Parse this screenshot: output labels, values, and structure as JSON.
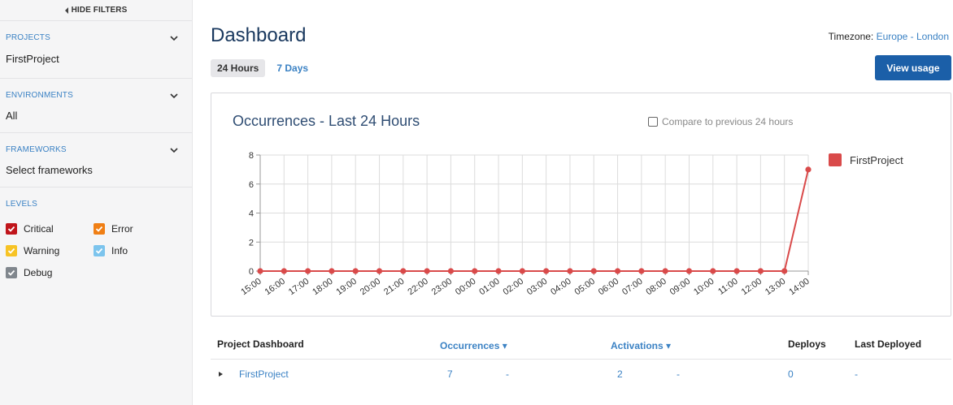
{
  "sidebar": {
    "hide_filters_label": "HIDE FILTERS",
    "projects": {
      "title": "PROJECTS",
      "value": "FirstProject"
    },
    "environments": {
      "title": "ENVIRONMENTS",
      "value": "All"
    },
    "frameworks": {
      "title": "FRAMEWORKS",
      "value": "Select frameworks"
    },
    "levels": {
      "title": "LEVELS",
      "items": [
        {
          "label": "Critical",
          "color": "#c0151b",
          "checked": true
        },
        {
          "label": "Error",
          "color": "#f07f15",
          "checked": true
        },
        {
          "label": "Warning",
          "color": "#f7c325",
          "checked": true
        },
        {
          "label": "Info",
          "color": "#7cc4ed",
          "checked": true
        },
        {
          "label": "Debug",
          "color": "#80868d",
          "checked": true
        }
      ]
    }
  },
  "header": {
    "title": "Dashboard",
    "timezone_label": "Timezone:",
    "timezone_value": "Europe - London",
    "view_usage_label": "View usage",
    "tabs": [
      {
        "label": "24 Hours",
        "active": true
      },
      {
        "label": "7 Days",
        "active": false
      }
    ]
  },
  "chart": {
    "compare_label": "Compare to previous 24 hours"
  },
  "chart_data": {
    "type": "line",
    "title": "Occurrences - Last 24 Hours",
    "categories": [
      "15:00",
      "16:00",
      "17:00",
      "18:00",
      "19:00",
      "20:00",
      "21:00",
      "22:00",
      "23:00",
      "00:00",
      "01:00",
      "02:00",
      "03:00",
      "04:00",
      "05:00",
      "06:00",
      "07:00",
      "08:00",
      "09:00",
      "10:00",
      "11:00",
      "12:00",
      "13:00",
      "14:00"
    ],
    "series": [
      {
        "name": "FirstProject",
        "color": "#d94a4a",
        "values": [
          0,
          0,
          0,
          0,
          0,
          0,
          0,
          0,
          0,
          0,
          0,
          0,
          0,
          0,
          0,
          0,
          0,
          0,
          0,
          0,
          0,
          0,
          0,
          7
        ]
      }
    ],
    "ylim": [
      0,
      8
    ],
    "yticks": [
      0,
      2,
      4,
      6,
      8
    ],
    "grid": true,
    "legend": "right"
  },
  "table": {
    "headers": {
      "project": "Project Dashboard",
      "occurrences": "Occurrences ▾",
      "activations": "Activations ▾",
      "deploys": "Deploys",
      "last_deployed": "Last Deployed"
    },
    "rows": [
      {
        "project": "FirstProject",
        "occurrences": "7",
        "occ_change": "-",
        "activations": "2",
        "act_change": "-",
        "deploys": "0",
        "last_deployed": "-"
      }
    ]
  },
  "icons": {
    "hide_filters": "caret-left-icon",
    "section_toggle": "chevron-down-icon",
    "check": "check-icon",
    "row_expand": "triangle-right-icon"
  }
}
